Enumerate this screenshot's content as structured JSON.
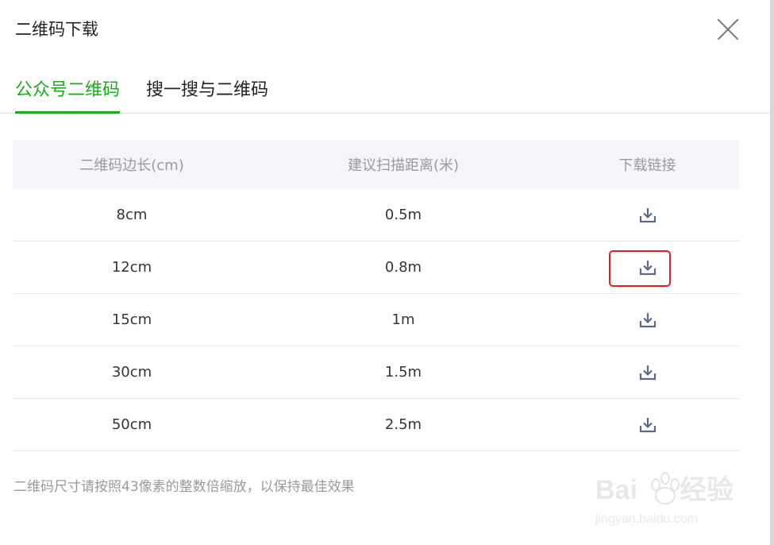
{
  "dialog": {
    "title": "二维码下载"
  },
  "tabs": [
    {
      "label": "公众号二维码",
      "active": true
    },
    {
      "label": "搜一搜与二维码",
      "active": false
    }
  ],
  "table": {
    "headers": [
      "二维码边长(cm)",
      "建议扫描距离(米)",
      "下载链接"
    ],
    "rows": [
      {
        "size": "8cm",
        "distance": "0.5m",
        "icon": "download-icon"
      },
      {
        "size": "12cm",
        "distance": "0.8m",
        "icon": "download-icon"
      },
      {
        "size": "15cm",
        "distance": "1m",
        "icon": "download-icon"
      },
      {
        "size": "30cm",
        "distance": "1.5m",
        "icon": "download-icon"
      },
      {
        "size": "50cm",
        "distance": "2.5m",
        "icon": "download-icon"
      }
    ]
  },
  "footer": {
    "note": "二维码尺寸请按照43像素的整数倍缩放，以保持最佳效果"
  },
  "watermark": {
    "brand": "Baidu经验",
    "url": "jingyan.baidu.com"
  },
  "colors": {
    "accent": "#1aad19",
    "icon": "#5a6a8f",
    "highlight": "#e02020"
  }
}
